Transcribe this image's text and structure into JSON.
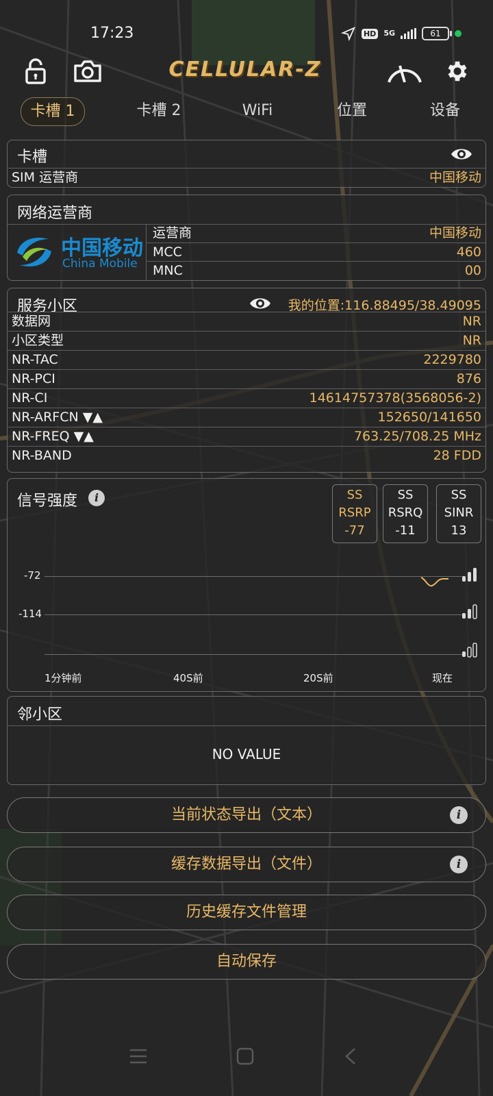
{
  "status_bar": {
    "time": "17:23",
    "net_type": "5G",
    "hd_label": "HD",
    "battery": "61"
  },
  "toolbar": {
    "app_name": "CELLULAR-Z",
    "icons": [
      "lock-icon",
      "camera-icon",
      "speedometer-icon",
      "gear-icon"
    ]
  },
  "tabs": [
    {
      "label": "卡槽 1",
      "active": true
    },
    {
      "label": "卡槽 2",
      "active": false
    },
    {
      "label": "WiFi",
      "active": false
    },
    {
      "label": "位置",
      "active": false
    },
    {
      "label": "设备",
      "active": false
    }
  ],
  "slot_panel": {
    "title": "卡槽",
    "sim_operator_label": "SIM 运营商",
    "sim_operator_value": "中国移动"
  },
  "network_panel": {
    "title": "网络运营商",
    "logo_cn": "中国移动",
    "logo_en": "China Mobile",
    "rows": [
      {
        "key": "运营商",
        "value": "中国移动"
      },
      {
        "key": "MCC",
        "value": "460"
      },
      {
        "key": "MNC",
        "value": "00"
      }
    ]
  },
  "serving_cell": {
    "title": "服务小区",
    "my_location": "我的位置:116.88495/38.49095",
    "rows": [
      {
        "key": "数据网",
        "value": "NR"
      },
      {
        "key": "小区类型",
        "value": "NR"
      },
      {
        "key": "NR-TAC",
        "value": "2229780"
      },
      {
        "key": "NR-PCI",
        "value": "876"
      },
      {
        "key": "NR-CI",
        "value": "14614757378(3568056-2)"
      },
      {
        "key": "NR-ARFCN ▼▲",
        "value": "152650/141650"
      },
      {
        "key": "NR-FREQ ▼▲",
        "value": "763.25/708.25 MHz"
      },
      {
        "key": "NR-BAND",
        "value": "28 FDD"
      }
    ]
  },
  "signal": {
    "title": "信号强度",
    "metrics": [
      {
        "line1": "SS",
        "line2": "RSRP",
        "value": "-77",
        "highlight": true
      },
      {
        "line1": "SS",
        "line2": "RSRQ",
        "value": "-11",
        "highlight": false
      },
      {
        "line1": "SS",
        "line2": "SINR",
        "value": "13",
        "highlight": false
      }
    ],
    "y_labels": [
      "-72",
      "-114"
    ],
    "x_labels": [
      "1分钟前",
      "40S前",
      "20S前",
      "现在"
    ]
  },
  "neighbor": {
    "title": "邻小区",
    "empty_text": "NO VALUE"
  },
  "actions": [
    {
      "label": "当前状态导出（文本）",
      "info": true,
      "gold": true
    },
    {
      "label": "缓存数据导出（文件）",
      "info": true,
      "gold": true
    },
    {
      "label": "历史缓存文件管理",
      "info": false,
      "gold": true
    },
    {
      "label": "自动保存",
      "info": false,
      "gold": true
    }
  ],
  "colors": {
    "accent": "#e8b866",
    "background": "#262626",
    "panel_border": "#6a6a6a",
    "rsrp_line": "#e8b866"
  }
}
